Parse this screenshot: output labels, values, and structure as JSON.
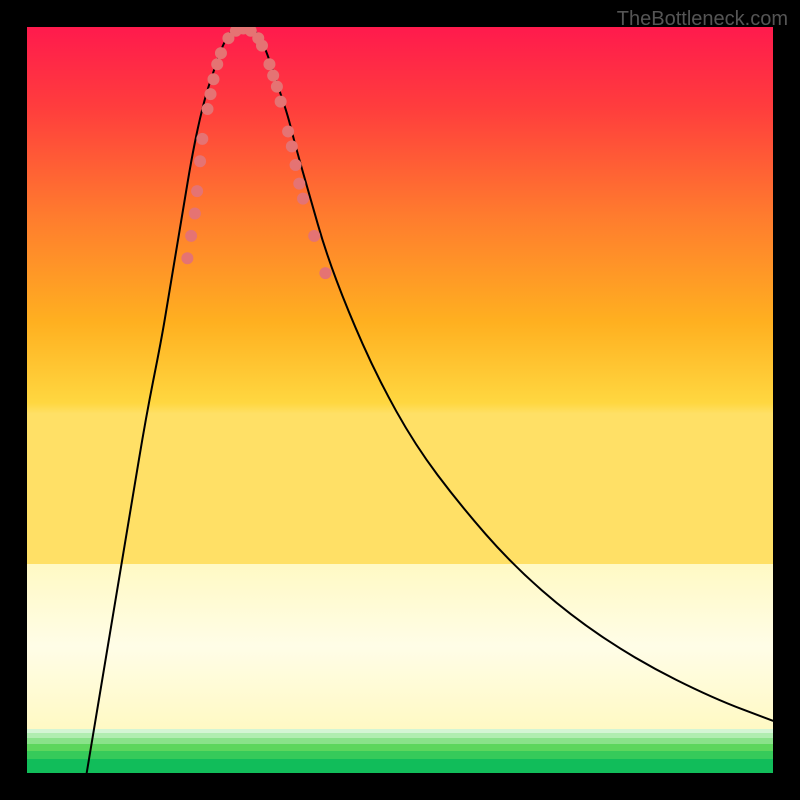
{
  "watermark": "TheBottleneck.com",
  "chart_data": {
    "type": "line",
    "title": "",
    "xlabel": "",
    "ylabel": "",
    "xlim": [
      0,
      100
    ],
    "ylim": [
      0,
      100
    ],
    "background_gradient": {
      "type": "vertical",
      "stops": [
        {
          "pos": 0,
          "color": "#ff1744"
        },
        {
          "pos": 50,
          "color": "#ffc107"
        },
        {
          "pos": 72,
          "color": "#ffeb3b"
        },
        {
          "pos": 78,
          "color": "#fff59d"
        },
        {
          "pos": 100,
          "color": "#00e676"
        }
      ]
    },
    "pale_band": {
      "top_pct": 72,
      "bottom_pct": 92,
      "color": "#fffde7"
    },
    "green_bands": [
      {
        "top_pct": 94.6,
        "height_pct": 0.5,
        "color": "#c8f7c5"
      },
      {
        "top_pct": 95.4,
        "height_pct": 0.6,
        "color": "#9ae6b4"
      },
      {
        "top_pct": 96.3,
        "height_pct": 0.7,
        "color": "#68d391"
      },
      {
        "top_pct": 97.3,
        "height_pct": 0.8,
        "color": "#48bb78"
      },
      {
        "top_pct": 98.4,
        "height_pct": 1.6,
        "color": "#00e676"
      }
    ],
    "series": [
      {
        "name": "curve",
        "type": "line",
        "color": "#000000",
        "stroke_width": 2,
        "points": [
          {
            "x": 8,
            "y": 0
          },
          {
            "x": 10,
            "y": 12
          },
          {
            "x": 12,
            "y": 24
          },
          {
            "x": 14,
            "y": 36
          },
          {
            "x": 16,
            "y": 48
          },
          {
            "x": 18,
            "y": 58
          },
          {
            "x": 19,
            "y": 64
          },
          {
            "x": 20,
            "y": 70
          },
          {
            "x": 21,
            "y": 76
          },
          {
            "x": 22,
            "y": 82
          },
          {
            "x": 23,
            "y": 87
          },
          {
            "x": 24,
            "y": 91
          },
          {
            "x": 25,
            "y": 94
          },
          {
            "x": 26,
            "y": 97
          },
          {
            "x": 27,
            "y": 99
          },
          {
            "x": 28,
            "y": 100
          },
          {
            "x": 30,
            "y": 100
          },
          {
            "x": 31,
            "y": 99
          },
          {
            "x": 32,
            "y": 97
          },
          {
            "x": 33,
            "y": 94
          },
          {
            "x": 34,
            "y": 91
          },
          {
            "x": 35,
            "y": 88
          },
          {
            "x": 36,
            "y": 84
          },
          {
            "x": 38,
            "y": 77
          },
          {
            "x": 40,
            "y": 70
          },
          {
            "x": 43,
            "y": 62
          },
          {
            "x": 47,
            "y": 53
          },
          {
            "x": 52,
            "y": 44
          },
          {
            "x": 58,
            "y": 36
          },
          {
            "x": 65,
            "y": 28
          },
          {
            "x": 73,
            "y": 21
          },
          {
            "x": 82,
            "y": 15
          },
          {
            "x": 92,
            "y": 10
          },
          {
            "x": 100,
            "y": 7
          }
        ]
      },
      {
        "name": "markers",
        "type": "scatter",
        "color": "#e57373",
        "radius": 6,
        "points": [
          {
            "x": 21.5,
            "y": 69
          },
          {
            "x": 22,
            "y": 72
          },
          {
            "x": 22.5,
            "y": 75
          },
          {
            "x": 22.8,
            "y": 78
          },
          {
            "x": 23.2,
            "y": 82
          },
          {
            "x": 23.5,
            "y": 85
          },
          {
            "x": 24.2,
            "y": 89
          },
          {
            "x": 24.6,
            "y": 91
          },
          {
            "x": 25,
            "y": 93
          },
          {
            "x": 25.5,
            "y": 95
          },
          {
            "x": 26,
            "y": 96.5
          },
          {
            "x": 27,
            "y": 98.5
          },
          {
            "x": 28,
            "y": 99.5
          },
          {
            "x": 29,
            "y": 99.8
          },
          {
            "x": 30,
            "y": 99.5
          },
          {
            "x": 31,
            "y": 98.5
          },
          {
            "x": 31.5,
            "y": 97.5
          },
          {
            "x": 32.5,
            "y": 95
          },
          {
            "x": 33,
            "y": 93.5
          },
          {
            "x": 33.5,
            "y": 92
          },
          {
            "x": 34,
            "y": 90
          },
          {
            "x": 35,
            "y": 86
          },
          {
            "x": 35.5,
            "y": 84
          },
          {
            "x": 36,
            "y": 81.5
          },
          {
            "x": 36.5,
            "y": 79
          },
          {
            "x": 37,
            "y": 77
          },
          {
            "x": 38.5,
            "y": 72
          },
          {
            "x": 40,
            "y": 67
          }
        ]
      }
    ]
  }
}
